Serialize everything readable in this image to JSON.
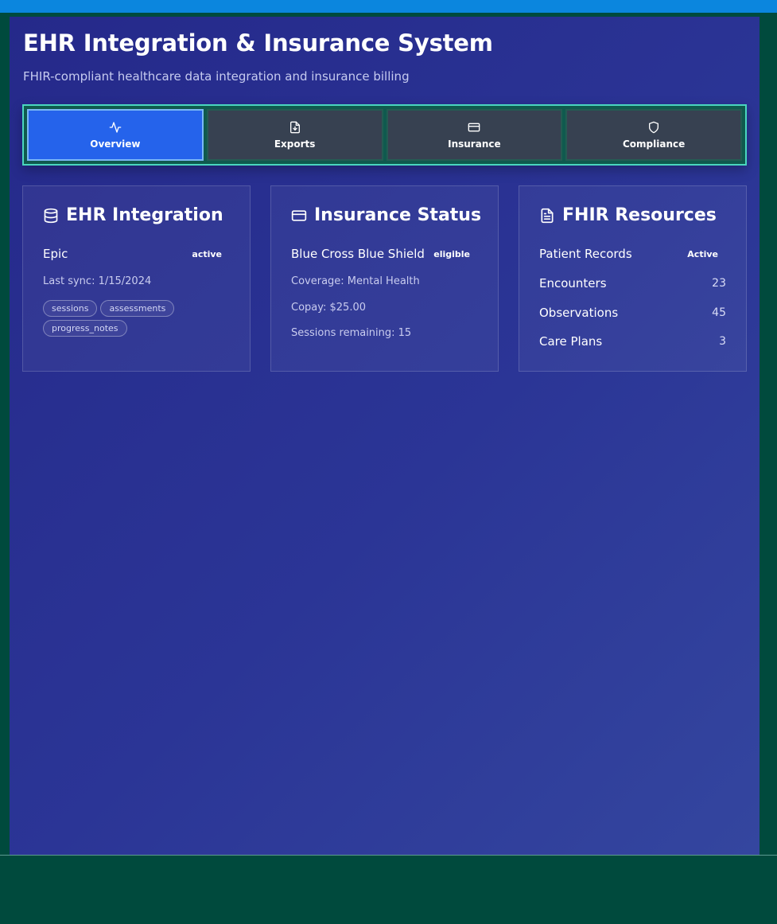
{
  "header": {
    "title": "EHR Integration & Insurance System",
    "subtitle": "FHIR-compliant healthcare data integration and insurance billing"
  },
  "tabs": [
    {
      "label": "Overview",
      "icon": "activity-icon",
      "active": true
    },
    {
      "label": "Exports",
      "icon": "file-download-icon",
      "active": false
    },
    {
      "label": "Insurance",
      "icon": "credit-card-icon",
      "active": false
    },
    {
      "label": "Compliance",
      "icon": "shield-icon",
      "active": false
    }
  ],
  "ehr": {
    "title": "EHR Integration",
    "icon": "database-icon",
    "provider": "Epic",
    "status": "active",
    "last_sync": "Last sync: 1/15/2024",
    "tags": [
      "sessions",
      "assessments",
      "progress_notes"
    ]
  },
  "insurance": {
    "title": "Insurance Status",
    "icon": "credit-card-icon",
    "payer": "Blue Cross Blue Shield",
    "status": "eligible",
    "coverage": "Coverage: Mental Health",
    "copay": "Copay: $25.00",
    "sessions_remaining": "Sessions remaining: 15"
  },
  "fhir": {
    "title": "FHIR Resources",
    "icon": "document-icon",
    "rows": [
      {
        "label": "Patient Records",
        "value": "Active"
      },
      {
        "label": "Encounters",
        "value": "23"
      },
      {
        "label": "Observations",
        "value": "45"
      },
      {
        "label": "Care Plans",
        "value": "3"
      }
    ]
  },
  "colors": {
    "accent": "#2563eb",
    "tab_inactive": "#374151",
    "tab_frame_border": "#4ad6bf",
    "panel_gradient_start": "#25298a",
    "panel_gradient_end": "#34469f",
    "outer_background": "#004a3d",
    "top_bar": "#0b86de"
  }
}
